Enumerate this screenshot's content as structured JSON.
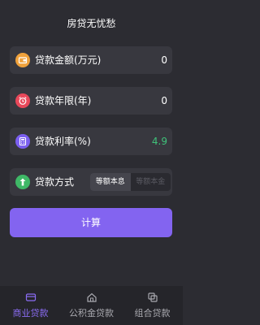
{
  "header": {
    "title": "房贷无忧愁"
  },
  "form": {
    "amount": {
      "label": "贷款金额(万元)",
      "value": "0",
      "icon": "wallet-icon",
      "color": "#f0a23c"
    },
    "years": {
      "label": "贷款年限(年)",
      "value": "0",
      "icon": "alarm-clock-icon",
      "color": "#e8485a"
    },
    "rate": {
      "label": "贷款利率(%)",
      "value": "4.9",
      "icon": "calculator-icon",
      "color": "#7b5ff0",
      "value_color": "#3fc27a"
    },
    "method": {
      "label": "贷款方式",
      "icon": "method-icon",
      "color": "#3fb867",
      "options": [
        "等额本息",
        "等额本金"
      ],
      "selected": "等额本息"
    }
  },
  "actions": {
    "calculate_label": "计算"
  },
  "tabbar": {
    "tabs": [
      {
        "label": "商业贷款",
        "icon": "card-icon",
        "active": true
      },
      {
        "label": "公积金贷款",
        "icon": "house-icon",
        "active": false
      },
      {
        "label": "组合贷款",
        "icon": "combine-icon",
        "active": false
      }
    ]
  },
  "colors": {
    "accent": "#8364f0",
    "background": "#2c2c32",
    "card": "#38383f"
  }
}
